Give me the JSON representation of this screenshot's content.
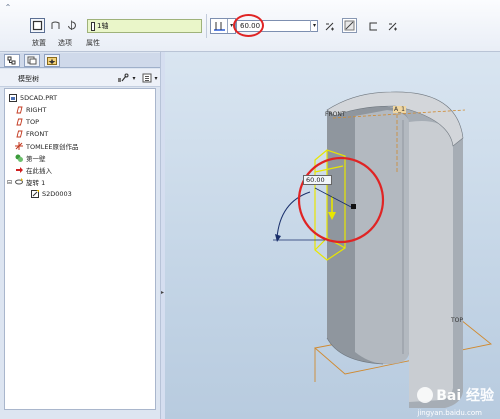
{
  "dashboard": {
    "axis_field_value": "1轴",
    "angle_value": "60.00",
    "tabs": [
      "放置",
      "选项",
      "属性"
    ]
  },
  "navigator": {
    "tree_header": "模型树",
    "items": [
      "5DCAD.PRT",
      "RIGHT",
      "TOP",
      "FRONT",
      "TOMLEE原创作品",
      "第一壁",
      "在此插入",
      "旋转 1",
      "S2D0003"
    ]
  },
  "graphics": {
    "label_front": "FRONT",
    "label_axis": "A_1",
    "label_top": "TOP",
    "dimension_value": "60.00",
    "watermark_main": "Bai 经验",
    "watermark_url": "jingyan.baidu.com"
  },
  "colors": {
    "axis_field_bg": "#eaf6c9",
    "highlight_ring": "#e02424",
    "preview_geometry": "#e8e600",
    "part_shade": "#9ea5ad"
  }
}
